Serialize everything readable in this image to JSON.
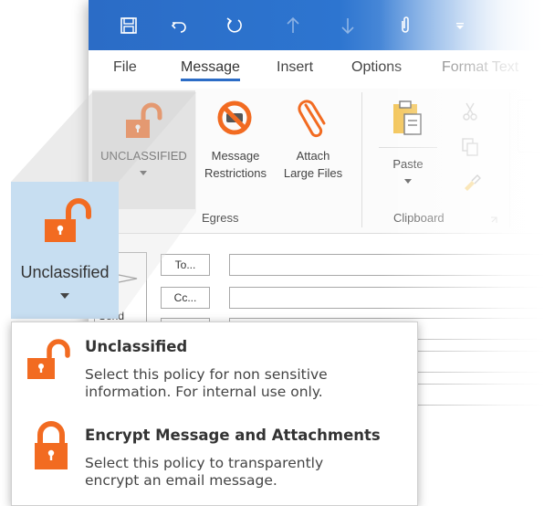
{
  "quick_access": {
    "icons": [
      "save-icon",
      "undo-icon",
      "redo-icon",
      "up-arrow-icon",
      "down-arrow-icon",
      "attach-icon",
      "customize-icon"
    ]
  },
  "tabs": [
    "File",
    "Message",
    "Insert",
    "Options",
    "Format Text"
  ],
  "active_tab": "Message",
  "ribbon": {
    "egress": {
      "unclassified_label": "UNCLASSIFIED",
      "restrictions_label_1": "Message",
      "restrictions_label_2": "Restrictions",
      "attach_label_1": "Attach",
      "attach_label_2": "Large Files",
      "group_label": "Egress"
    },
    "clipboard": {
      "paste_label": "Paste",
      "group_label": "Clipboard"
    }
  },
  "compose": {
    "to_label": "To...",
    "cc_label": "Cc...",
    "send_label": "Send"
  },
  "zoom": {
    "label": "Unclassified"
  },
  "dropdown": {
    "options": [
      {
        "title": "Unclassified",
        "desc_1": "Select this policy for non sensitive",
        "desc_2": "information. For internal use only."
      },
      {
        "title": "Encrypt Message and Attachments",
        "desc_1": "Select this policy to transparently",
        "desc_2": "encrypt an email message."
      }
    ]
  },
  "colors": {
    "accent_blue": "#2b6cc6",
    "lock_orange": "#f26b21",
    "zoom_tile": "#c7def1"
  }
}
